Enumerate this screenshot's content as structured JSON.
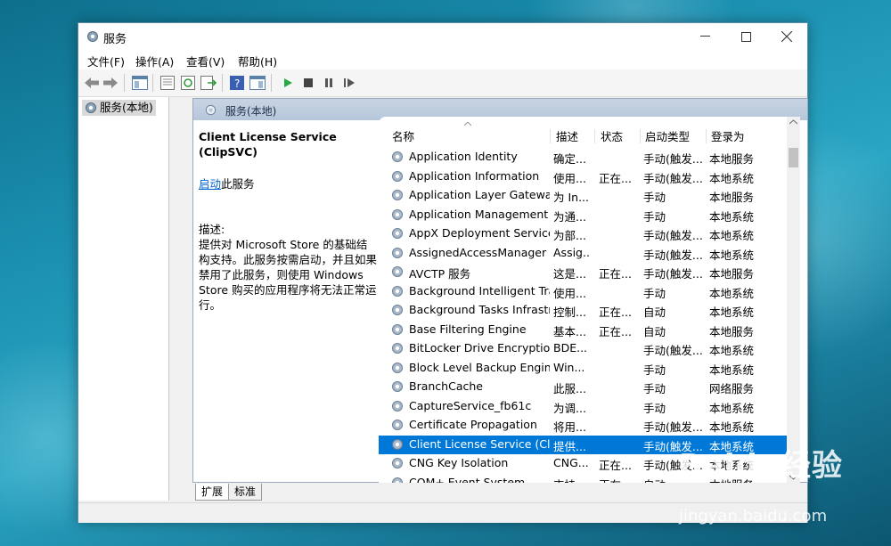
{
  "window": {
    "title": "服务"
  },
  "menu": [
    "文件(F)",
    "操作(A)",
    "查看(V)",
    "帮助(H)"
  ],
  "tree": {
    "item": "服务(本地)"
  },
  "pane_header": "服务(本地)",
  "detail": {
    "service_title": "Client License Service (ClipSVC)",
    "start_link": "启动",
    "start_suffix": "此服务",
    "desc_label": "描述:",
    "description": "提供对 Microsoft Store 的基础结构支持。此服务按需启动，并且如果禁用了此服务，则使用 Windows Store 购买的应用程序将无法正常运行。"
  },
  "columns": [
    "名称",
    "描述",
    "状态",
    "启动类型",
    "登录为"
  ],
  "rows": [
    {
      "name": "Application Identity",
      "desc": "确定...",
      "status": "",
      "startup": "手动(触发...",
      "logon": "本地服务"
    },
    {
      "name": "Application Information",
      "desc": "使用...",
      "status": "正在...",
      "startup": "手动(触发...",
      "logon": "本地系统"
    },
    {
      "name": "Application Layer Gateway ...",
      "desc": "为 In...",
      "status": "",
      "startup": "手动",
      "logon": "本地服务"
    },
    {
      "name": "Application Management",
      "desc": "为通...",
      "status": "",
      "startup": "手动",
      "logon": "本地系统"
    },
    {
      "name": "AppX Deployment Service ...",
      "desc": "为部...",
      "status": "",
      "startup": "手动(触发...",
      "logon": "本地系统"
    },
    {
      "name": "AssignedAccessManager ...",
      "desc": "Assig...",
      "status": "",
      "startup": "手动(触发...",
      "logon": "本地系统"
    },
    {
      "name": "AVCTP 服务",
      "desc": "这是...",
      "status": "正在...",
      "startup": "手动(触发...",
      "logon": "本地服务"
    },
    {
      "name": "Background Intelligent Tra...",
      "desc": "使用...",
      "status": "",
      "startup": "手动",
      "logon": "本地系统"
    },
    {
      "name": "Background Tasks Infrastru...",
      "desc": "控制...",
      "status": "正在...",
      "startup": "自动",
      "logon": "本地系统"
    },
    {
      "name": "Base Filtering Engine",
      "desc": "基本...",
      "status": "正在...",
      "startup": "自动",
      "logon": "本地服务"
    },
    {
      "name": "BitLocker Drive Encryption ...",
      "desc": "BDE...",
      "status": "",
      "startup": "手动(触发...",
      "logon": "本地系统"
    },
    {
      "name": "Block Level Backup Engine ...",
      "desc": "Win...",
      "status": "",
      "startup": "手动",
      "logon": "本地系统"
    },
    {
      "name": "BranchCache",
      "desc": "此服...",
      "status": "",
      "startup": "手动",
      "logon": "网络服务"
    },
    {
      "name": "CaptureService_fb61c",
      "desc": "为调...",
      "status": "",
      "startup": "手动",
      "logon": "本地系统"
    },
    {
      "name": "Certificate Propagation",
      "desc": "将用...",
      "status": "",
      "startup": "手动(触发...",
      "logon": "本地系统"
    },
    {
      "name": "Client License Service (Clip...",
      "desc": "提供...",
      "status": "",
      "startup": "手动(触发...",
      "logon": "本地系统",
      "selected": true
    },
    {
      "name": "CNG Key Isolation",
      "desc": "CNG...",
      "status": "正在...",
      "startup": "手动(触发...",
      "logon": "本地系统"
    },
    {
      "name": "COM+ Event System",
      "desc": "支持...",
      "status": "正在...",
      "startup": "自动",
      "logon": "本地服务"
    }
  ],
  "tabs": [
    "扩展",
    "标准"
  ],
  "watermark": {
    "main": "Baidu经验",
    "sub": "jingyan.baidu.com"
  }
}
